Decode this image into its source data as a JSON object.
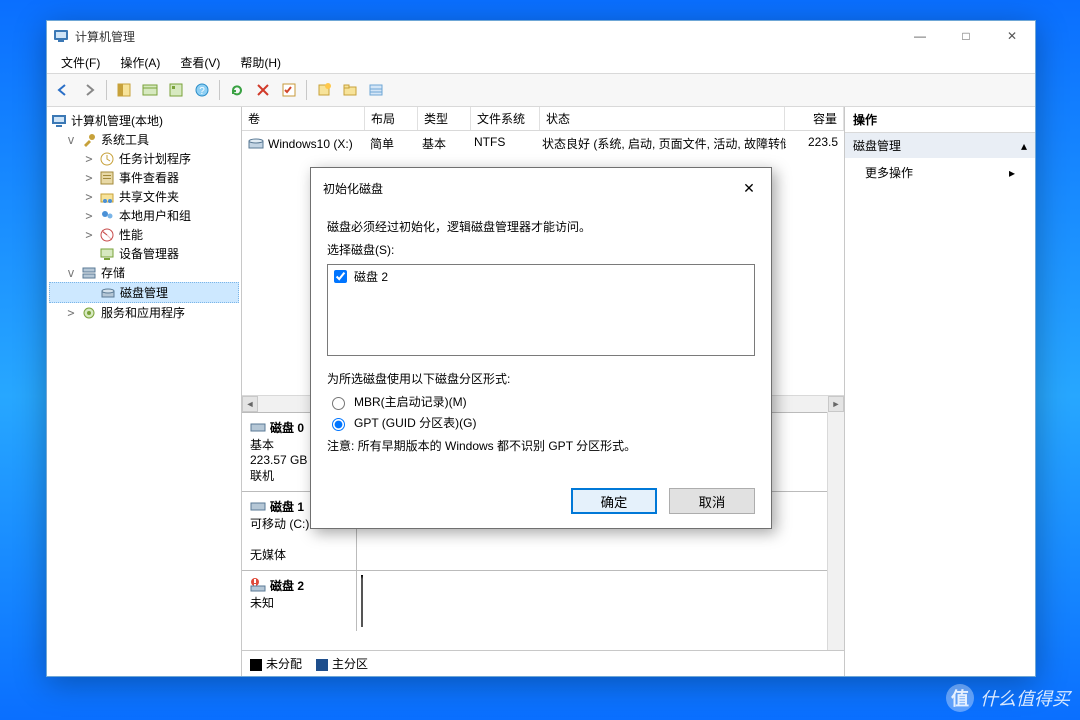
{
  "window": {
    "title": "计算机管理",
    "controls": {
      "min": "—",
      "max": "□",
      "close": "✕"
    }
  },
  "menu": {
    "file": "文件(F)",
    "action": "操作(A)",
    "view": "查看(V)",
    "help": "帮助(H)"
  },
  "tree": {
    "root": "计算机管理(本地)",
    "systools": "系统工具",
    "scheduler": "任务计划程序",
    "eventvwr": "事件查看器",
    "shared": "共享文件夹",
    "localusers": "本地用户和组",
    "perf": "性能",
    "devmgr": "设备管理器",
    "storage": "存储",
    "diskmgmt": "磁盘管理",
    "services": "服务和应用程序"
  },
  "vols": {
    "hdr": {
      "vol": "卷",
      "layout": "布局",
      "type": "类型",
      "fs": "文件系统",
      "status": "状态",
      "cap": "容量"
    },
    "row": {
      "vol": "Windows10 (X:)",
      "layout": "简单",
      "type": "基本",
      "fs": "NTFS",
      "status": "状态良好 (系统, 启动, 页面文件, 活动, 故障转储, 主分区)",
      "cap": "223.5"
    }
  },
  "disks": {
    "d0": {
      "name": "磁盘 0",
      "kind": "基本",
      "size": "223.57 GB",
      "state": "联机"
    },
    "d1": {
      "name": "磁盘 1",
      "kind": "可移动 (C:)",
      "media": "无媒体"
    },
    "d2": {
      "name": "磁盘 2",
      "kind": "未知"
    }
  },
  "legend": {
    "unalloc": "未分配",
    "primary": "主分区"
  },
  "rightpane": {
    "hdr": "操作",
    "cat": "磁盘管理",
    "more": "更多操作"
  },
  "modal": {
    "title": "初始化磁盘",
    "intro": "磁盘必须经过初始化，逻辑磁盘管理器才能访问。",
    "select": "选择磁盘(S):",
    "item": "磁盘 2",
    "partstyle": "为所选磁盘使用以下磁盘分区形式:",
    "mbr": "MBR(主启动记录)(M)",
    "gpt": "GPT (GUID 分区表)(G)",
    "note": "注意: 所有早期版本的 Windows 都不识别 GPT 分区形式。",
    "ok": "确定",
    "cancel": "取消"
  },
  "watermark": "什么值得买"
}
